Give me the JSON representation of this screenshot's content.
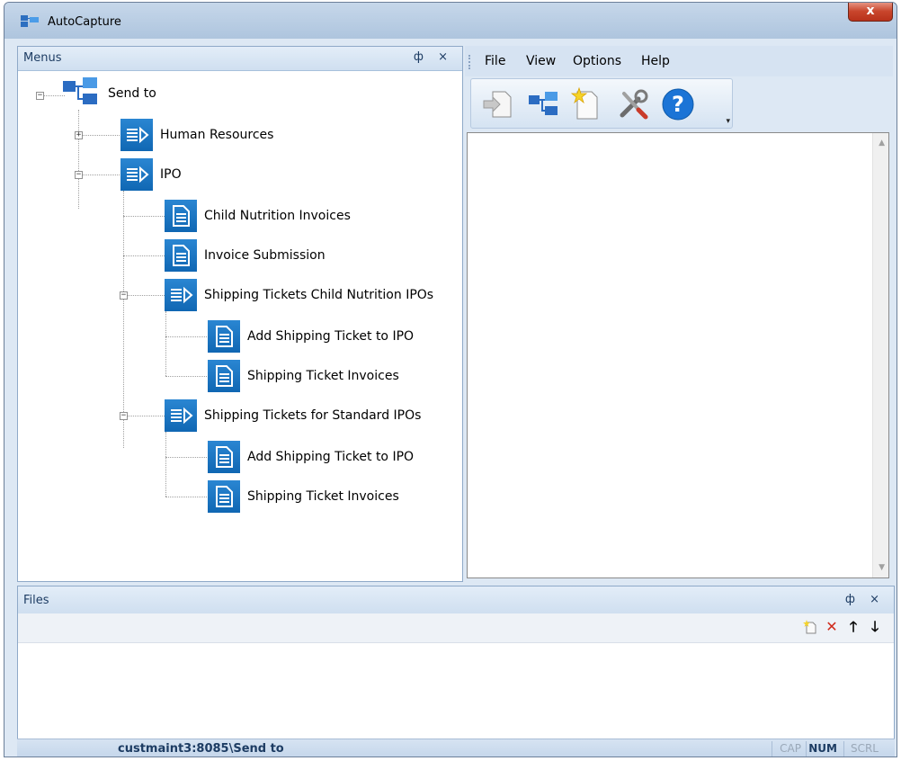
{
  "window": {
    "title": "AutoCapture",
    "close_label": "x"
  },
  "menus_panel": {
    "title": "Menus",
    "pin_label": "ф",
    "close_label": "×"
  },
  "tree": {
    "root": {
      "label": "Send to",
      "icon": "hierarchy-icon"
    },
    "nodes": [
      {
        "label": "Human Resources",
        "icon": "menu-list-icon",
        "expander": "+"
      },
      {
        "label": "IPO",
        "icon": "menu-list-icon",
        "expander": "−"
      },
      {
        "label": "Child Nutrition Invoices",
        "icon": "document-icon"
      },
      {
        "label": "Invoice Submission",
        "icon": "document-icon"
      },
      {
        "label": "Shipping Tickets Child Nutrition IPOs",
        "icon": "menu-list-icon",
        "expander": "−"
      },
      {
        "label": "Add Shipping Ticket to IPO",
        "icon": "document-icon"
      },
      {
        "label": "Shipping Ticket Invoices",
        "icon": "document-icon"
      },
      {
        "label": "Shipping Tickets for Standard IPOs",
        "icon": "menu-list-icon",
        "expander": "−"
      },
      {
        "label": "Add Shipping Ticket to IPO",
        "icon": "document-icon"
      },
      {
        "label": "Shipping Ticket Invoices",
        "icon": "document-icon"
      }
    ]
  },
  "menubar": {
    "items": [
      "File",
      "View",
      "Options",
      "Help"
    ]
  },
  "toolbar": {
    "buttons": [
      "send-document-icon",
      "hierarchy-icon",
      "new-document-icon",
      "tools-icon",
      "help-icon"
    ]
  },
  "files_panel": {
    "title": "Files",
    "pin_label": "ф",
    "close_label": "×",
    "toolbar": [
      "new-file-icon",
      "delete-icon",
      "move-up-icon",
      "move-down-icon"
    ]
  },
  "statusbar": {
    "path": "custmaint3:8085\\Send to",
    "cap": "CAP",
    "num": "NUM",
    "scrl": "SCRL"
  },
  "colors": {
    "accent": "#1067b3",
    "header_text": "#1d3c63",
    "close_button": "#c9452c"
  }
}
